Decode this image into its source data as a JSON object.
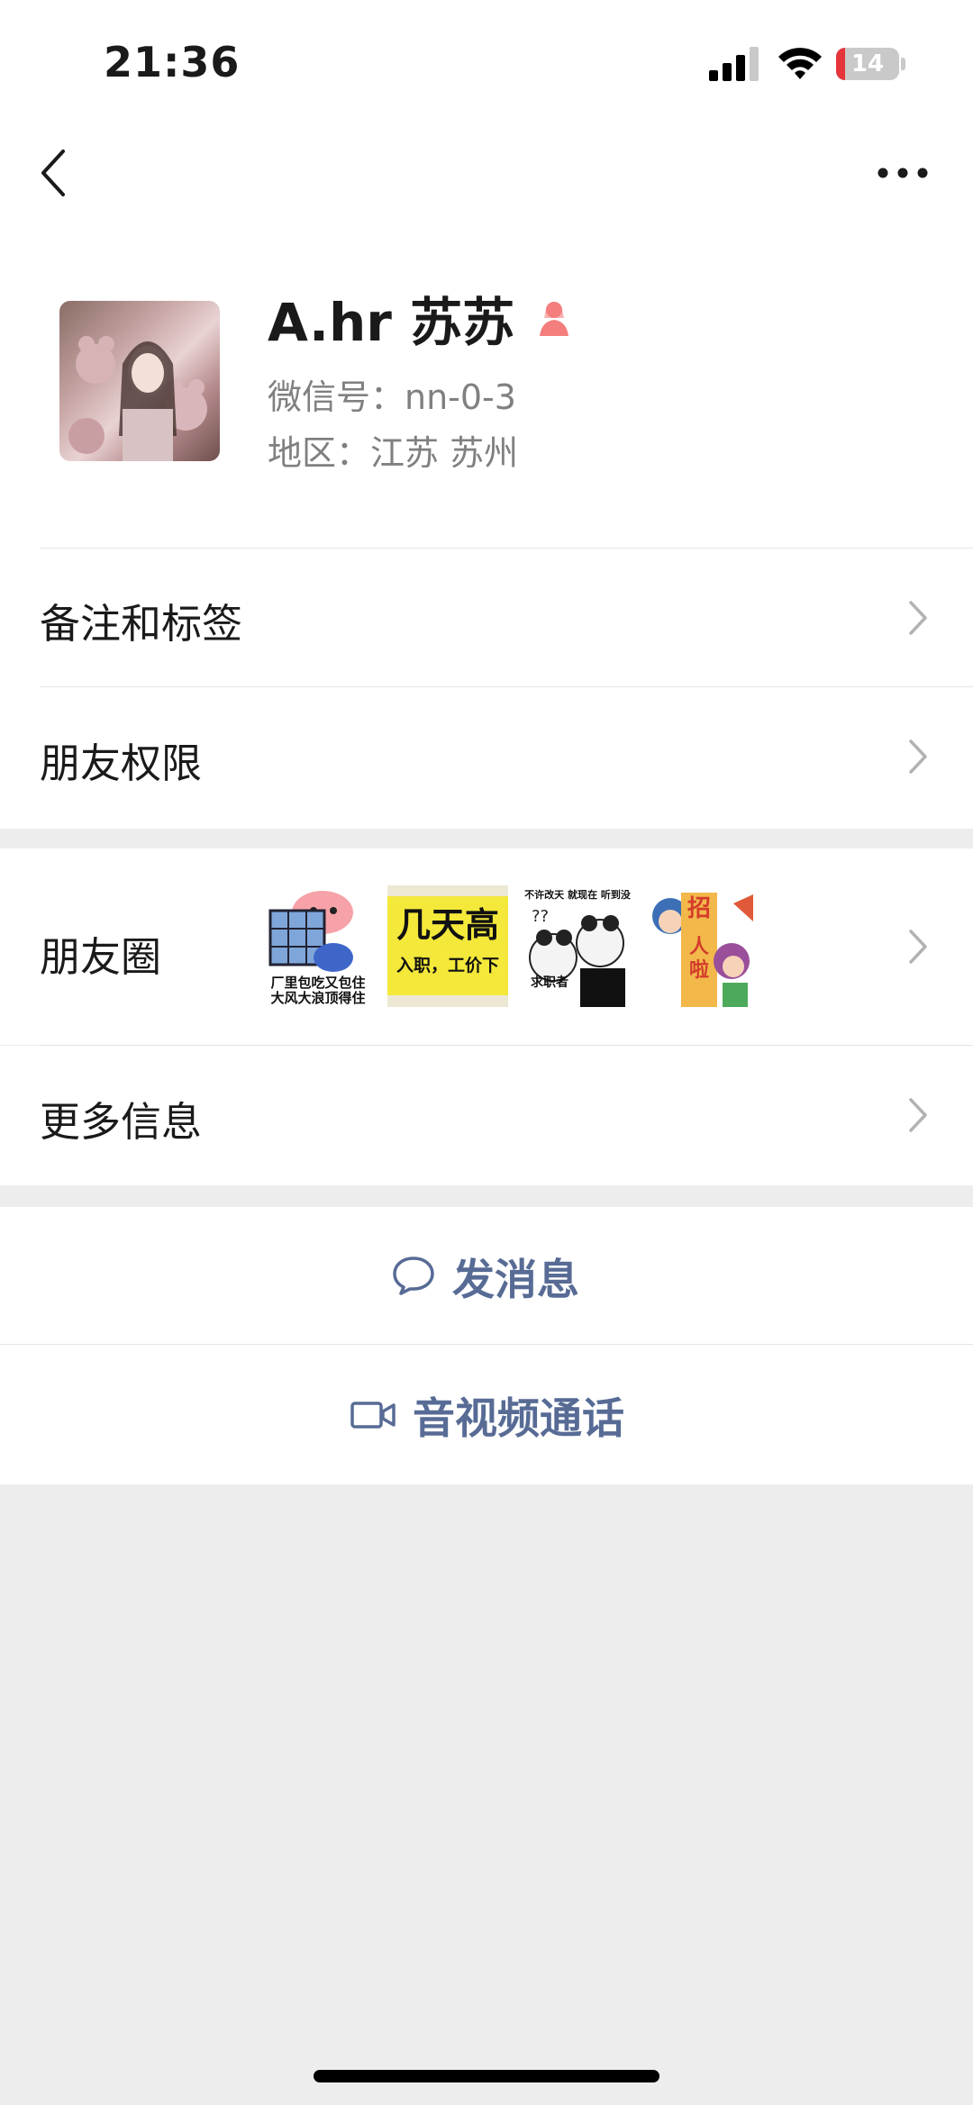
{
  "status_bar": {
    "time": "21:36",
    "battery_level": "14",
    "battery_fraction": 0.14
  },
  "nav": {
    "back_icon": "chevron-left-icon",
    "more_icon": "more-dots-icon"
  },
  "profile": {
    "name": "A.hr 苏苏",
    "wechat_id": "微信号：nn-0-3",
    "region": "地区：江苏 苏州",
    "gender_icon": "female-icon",
    "gender_color": "#f37e7d"
  },
  "menu": {
    "remarks_tags": "备注和标签",
    "friend_permissions": "朋友权限",
    "moments": "朋友圈",
    "more_info": "更多信息"
  },
  "moments_thumbs": [
    {
      "caption_line1": "厂里包吃又包住",
      "caption_line2": "大风大浪顶得住"
    },
    {
      "caption_line1": "几天高",
      "caption_line2": "入职，工价下"
    },
    {
      "caption_line1": "不许改天 就现在 听到没",
      "caption_line2": "求职者"
    },
    {
      "caption_line1": "招",
      "caption_line2": "人 啦"
    }
  ],
  "actions": {
    "send_message": "发消息",
    "av_call": "音视频通话"
  },
  "colors": {
    "link_blue": "#576b95",
    "background": "#ededed",
    "battery_red": "#e5343a"
  }
}
